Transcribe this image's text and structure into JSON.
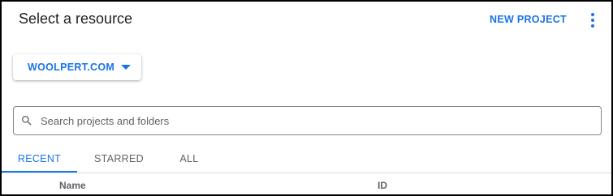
{
  "dialog": {
    "title": "Select a resource",
    "new_project_label": "NEW PROJECT",
    "more_icon": "more-vert-icon"
  },
  "organization": {
    "selected": "WOOLPERT.COM",
    "icon": "arrow-drop-down-icon"
  },
  "search": {
    "placeholder": "Search projects and folders",
    "value": "",
    "icon": "search-icon"
  },
  "tabs": [
    {
      "label": "RECENT",
      "active": true
    },
    {
      "label": "STARRED",
      "active": false
    },
    {
      "label": "ALL",
      "active": false
    }
  ],
  "table": {
    "columns": [
      "Name",
      "ID"
    ]
  },
  "colors": {
    "accent": "#1a73e8",
    "text_primary": "#202124",
    "text_secondary": "#5f6368",
    "border": "#80868b"
  }
}
